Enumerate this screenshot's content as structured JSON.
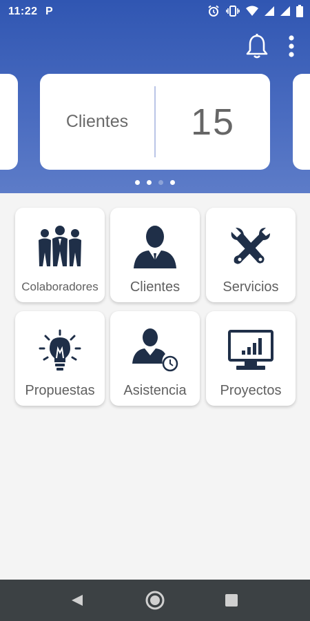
{
  "status_bar": {
    "time": "11:22",
    "app_badge": "P",
    "icons": [
      "alarm-icon",
      "vibrate-icon",
      "wifi-icon",
      "signal-icon",
      "signal-icon",
      "battery-icon"
    ]
  },
  "header": {
    "actions": [
      "bell-icon",
      "more-vert-icon"
    ]
  },
  "summary_card": {
    "label": "Clientes",
    "value": "15"
  },
  "carousel": {
    "page_count": 4,
    "active_index": 2
  },
  "tiles": [
    {
      "label": "Colaboradores",
      "icon": "team-icon"
    },
    {
      "label": "Clientes",
      "icon": "client-person-icon"
    },
    {
      "label": "Servicios",
      "icon": "tools-icon"
    },
    {
      "label": "Propuestas",
      "icon": "lightbulb-icon"
    },
    {
      "label": "Asistencia",
      "icon": "attendance-icon"
    },
    {
      "label": "Proyectos",
      "icon": "monitor-chart-icon"
    }
  ],
  "colors": {
    "header_blue": "#3056b2",
    "icon_navy": "#1f2f48",
    "nav_bar": "#3c4144",
    "background": "#f4f4f4"
  },
  "nav": [
    "back-icon",
    "home-icon",
    "recents-icon"
  ]
}
